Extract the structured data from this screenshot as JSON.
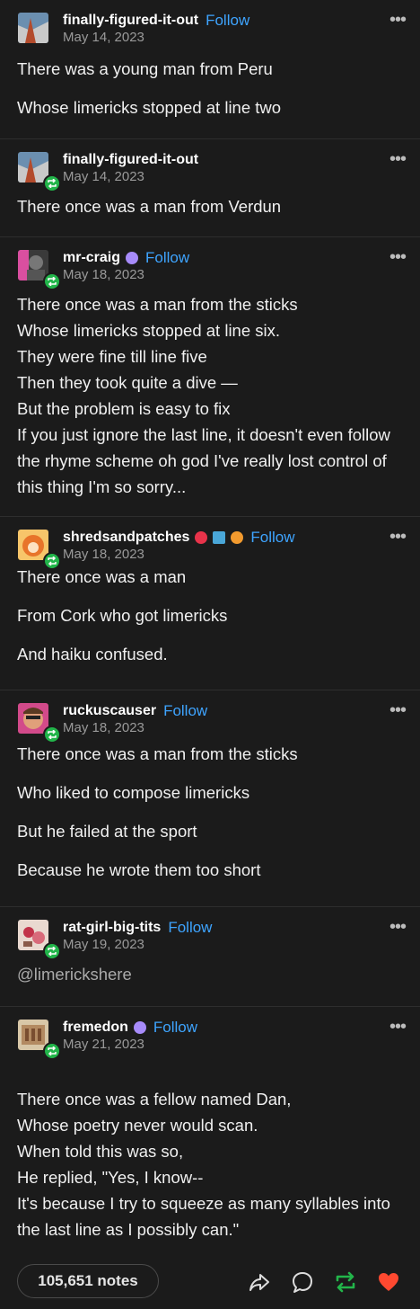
{
  "posts": [
    {
      "username": "finally-figured-it-out",
      "follow": "Follow",
      "date": "May 14, 2023",
      "lines": [
        "There was a young man from Peru",
        "Whose limericks stopped at line two"
      ]
    },
    {
      "username": "finally-figured-it-out",
      "date": "May 14, 2023",
      "lines": [
        "There once was a man from Verdun"
      ]
    },
    {
      "username": "mr-craig",
      "follow": "Follow",
      "date": "May 18, 2023",
      "lines": [
        "There once was a man from the sticks",
        "Whose limericks stopped at line six.",
        "They were fine till line five",
        "Then they took quite a dive —",
        "But the problem is easy to fix",
        "If you just ignore the last line, it doesn't even follow the rhyme scheme oh god I've really lost control of this thing I'm so sorry..."
      ]
    },
    {
      "username": "shredsandpatches",
      "follow": "Follow",
      "date": "May 18, 2023",
      "lines": [
        "There once was a man",
        "From Cork who got limericks",
        "And haiku confused."
      ]
    },
    {
      "username": "ruckuscauser",
      "follow": "Follow",
      "date": "May 18, 2023",
      "lines": [
        "There once was a man from the sticks",
        "Who liked to compose limericks",
        "But he failed at the sport",
        "Because he wrote them too short"
      ]
    },
    {
      "username": "rat-girl-big-tits",
      "follow": "Follow",
      "date": "May 19, 2023",
      "lines": [
        "@limerickshere"
      ]
    },
    {
      "username": "fremedon",
      "follow": "Follow",
      "date": "May 21, 2023",
      "lines": [
        "There once was a fellow named Dan,",
        "Whose poetry never would scan.",
        "When told this was so,",
        "He replied, \"Yes, I know--",
        "It's because I try to squeeze as many syllables into the last line as I possibly can.\""
      ]
    }
  ],
  "footer": {
    "notes": "105,651 notes",
    "icons": [
      "share-icon",
      "reply-icon",
      "reblog-icon",
      "like-icon"
    ],
    "reblog_color": "#22b54a",
    "like_color": "#ff4930"
  },
  "colors": {
    "link": "#3ea4ff",
    "background": "#1b1b1b",
    "reblog_badge": "#22b54a"
  }
}
